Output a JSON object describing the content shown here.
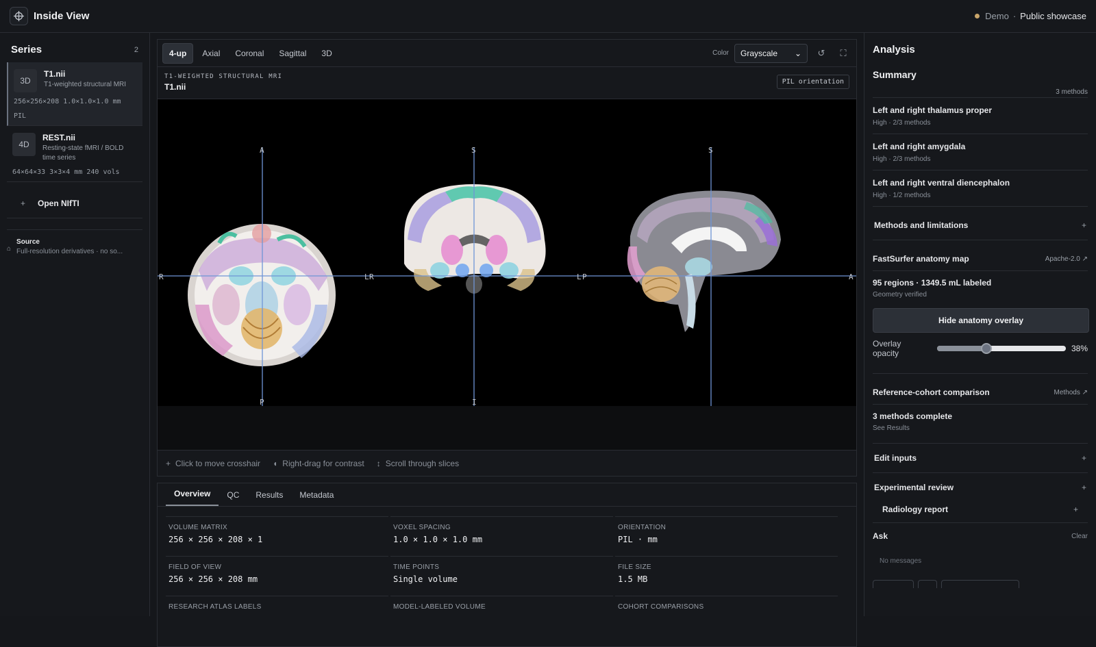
{
  "app": {
    "title": "Inside View",
    "mode": "Demo",
    "separator": "·",
    "showcase": "Public showcase"
  },
  "sidebar": {
    "title": "Series",
    "count": "2",
    "items": [
      {
        "badge": "3D",
        "name": "T1.nii",
        "desc": "T1-weighted structural MRI",
        "meta": "256×256×208  1.0×1.0×1.0 mm",
        "meta2": "PIL"
      },
      {
        "badge": "4D",
        "name": "REST.nii",
        "desc": "Resting-state fMRI / BOLD time series",
        "meta": "64×64×33  3×3×4 mm  240 vols"
      }
    ],
    "open_label": "Open NIfTI",
    "source_title": "Source",
    "source_text": "Full-resolution derivatives · no so..."
  },
  "viewer": {
    "tabs": [
      "4-up",
      "Axial",
      "Coronal",
      "Sagittal",
      "3D"
    ],
    "active_tab": "4-up",
    "color_label": "Color",
    "color_value": "Grayscale",
    "kicker": "T1-WEIGHTED STRUCTURAL MRI",
    "file": "T1.nii",
    "orientation_badge": "PIL orientation",
    "markers": {
      "axial": {
        "top": "A",
        "bottom": "P",
        "left": "R",
        "right": "L"
      },
      "coronal": {
        "top": "S",
        "bottom": "I",
        "left": "R",
        "right": "L"
      },
      "sagittal": {
        "top": "S",
        "left": "P",
        "right": "A"
      }
    },
    "hints": [
      "Click to move crosshair",
      "Right-drag for contrast",
      "Scroll through slices"
    ]
  },
  "info": {
    "tabs": [
      "Overview",
      "QC",
      "Results",
      "Metadata"
    ],
    "active_tab": "Overview",
    "cells": [
      {
        "label": "VOLUME MATRIX",
        "value": "256 × 256 × 208 × 1"
      },
      {
        "label": "VOXEL SPACING",
        "value": "1.0 × 1.0 × 1.0 mm"
      },
      {
        "label": "ORIENTATION",
        "value": "PIL · mm"
      },
      {
        "label": "FIELD OF VIEW",
        "value": "256 × 256 × 208 mm"
      },
      {
        "label": "TIME POINTS",
        "value": "Single volume"
      },
      {
        "label": "FILE SIZE",
        "value": "1.5 MB"
      },
      {
        "label": "RESEARCH ATLAS LABELS",
        "value": ""
      },
      {
        "label": "MODEL-LABELED VOLUME",
        "value": ""
      },
      {
        "label": "COHORT COMPARISONS",
        "value": ""
      }
    ]
  },
  "analysis": {
    "title": "Analysis",
    "summary_title": "Summary",
    "summary_count": "3 methods",
    "findings": [
      {
        "title": "Left and right thalamus proper",
        "sub": "High · 2/3 methods"
      },
      {
        "title": "Left and right amygdala",
        "sub": "High · 2/3 methods"
      },
      {
        "title": "Left and right ventral diencephalon",
        "sub": "High · 1/2 methods"
      }
    ],
    "methods_label": "Methods and limitations",
    "fastsurfer": {
      "title": "FastSurfer anatomy map",
      "link": "Apache-2.0 ↗",
      "stat": "95 regions · 1349.5 mL labeled",
      "sub": "Geometry verified",
      "button": "Hide anatomy overlay",
      "opacity_label": "Overlay opacity",
      "opacity_value": "38%",
      "opacity_fraction": 0.38
    },
    "cohort": {
      "title": "Reference-cohort comparison",
      "link": "Methods ↗",
      "stat": "3 methods complete",
      "sub": "See Results"
    },
    "edit_inputs": "Edit inputs",
    "experimental": "Experimental review",
    "radiology": "Radiology report",
    "ask_title": "Ask",
    "ask_clear": "Clear",
    "ask_empty": "No messages"
  },
  "colors": {
    "crosshair": "#6f95d6",
    "background": "#15171b",
    "panel": "#16181c",
    "status_dot": "#c9a56a"
  }
}
